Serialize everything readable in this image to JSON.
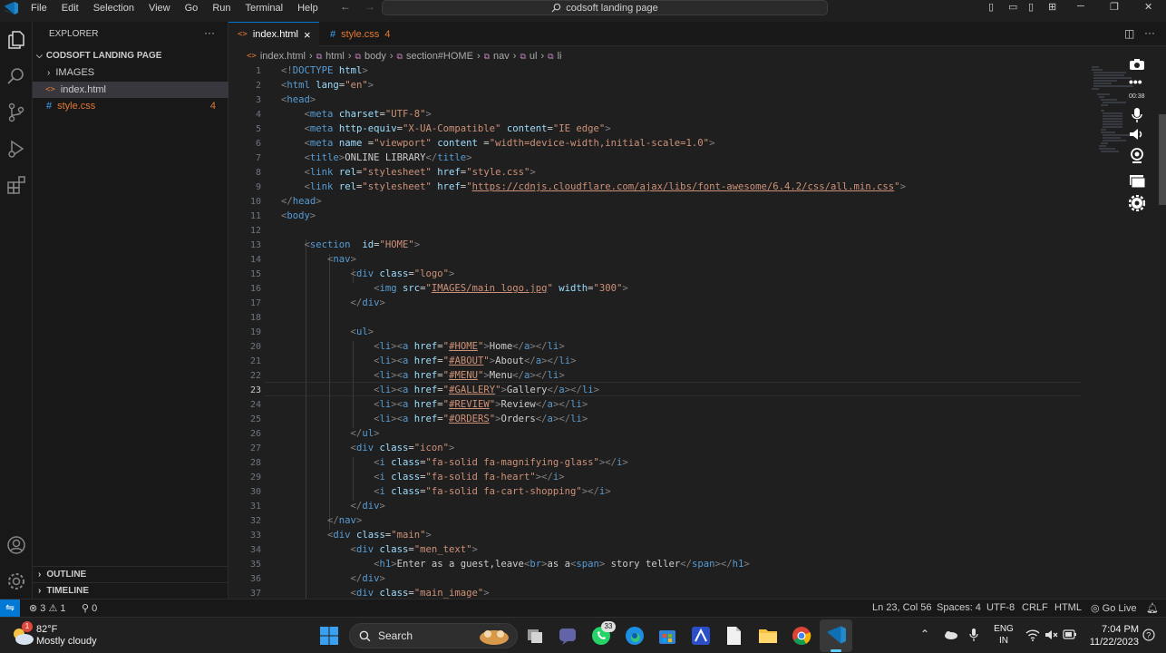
{
  "titlebar": {
    "menu": [
      "File",
      "Edit",
      "Selection",
      "View",
      "Go",
      "Run",
      "Terminal",
      "Help"
    ],
    "search": "codsoft landing page"
  },
  "explorer": {
    "header": "EXPLORER",
    "more": "···",
    "folder": "CODSOFT LANDING PAGE",
    "items": [
      {
        "name": "IMAGES",
        "type": "folder"
      },
      {
        "name": "index.html",
        "type": "html"
      },
      {
        "name": "style.css",
        "type": "css",
        "badge": "4"
      }
    ],
    "outline": "OUTLINE",
    "timeline": "TIMELINE"
  },
  "tabs": [
    {
      "label": "index.html",
      "active": true,
      "close": "×"
    },
    {
      "label": "style.css",
      "badge": "4"
    }
  ],
  "breadcrumb": [
    "index.html",
    "html",
    "body",
    "section#HOME",
    "nav",
    "ul",
    "li"
  ],
  "recorder": {
    "time": "00:38"
  },
  "editor": {
    "current_line": 23,
    "lines": [
      {
        "n": "1",
        "html": "<span class='t'>&lt;!</span><span class='n'>DOCTYPE</span> <span class='a'>html</span><span class='t'>&gt;</span>"
      },
      {
        "n": "2",
        "html": "<span class='t'>&lt;</span><span class='n'>html</span> <span class='a'>lang</span>=<span class='s'>\"en\"</span><span class='t'>&gt;</span>"
      },
      {
        "n": "3",
        "html": "<span class='t'>&lt;</span><span class='n'>head</span><span class='t'>&gt;</span>"
      },
      {
        "n": "4",
        "html": "    <span class='t'>&lt;</span><span class='n'>meta</span> <span class='a'>charset</span>=<span class='s'>\"UTF-8\"</span><span class='t'>&gt;</span>"
      },
      {
        "n": "5",
        "html": "    <span class='t'>&lt;</span><span class='n'>meta</span> <span class='a'>http-equiv</span>=<span class='s'>\"X-UA-Compatible\"</span> <span class='a'>content</span>=<span class='s'>\"IE edge\"</span><span class='t'>&gt;</span>"
      },
      {
        "n": "6",
        "html": "    <span class='t'>&lt;</span><span class='n'>meta</span> <span class='a'>name</span> =<span class='s'>\"viewport\"</span> <span class='a'>content</span> =<span class='s'>\"width=device-width,initial-scale=1.0\"</span><span class='t'>&gt;</span>"
      },
      {
        "n": "7",
        "html": "    <span class='t'>&lt;</span><span class='n'>title</span><span class='t'>&gt;</span>ONLINE LIBRARY<span class='t'>&lt;/</span><span class='n'>title</span><span class='t'>&gt;</span>"
      },
      {
        "n": "8",
        "html": "    <span class='t'>&lt;</span><span class='n'>link</span> <span class='a'>rel</span>=<span class='s'>\"stylesheet\"</span> <span class='a'>href</span>=<span class='s'>\"style.css\"</span><span class='t'>&gt;</span>"
      },
      {
        "n": "9",
        "html": "    <span class='t'>&lt;</span><span class='n'>link</span> <span class='a'>rel</span>=<span class='s'>\"stylesheet\"</span> <span class='a'>href</span>=<span class='s'>\"<span class='u'>https://cdnjs.cloudflare.com/ajax/libs/font-awesome/6.4.2/css/all.min.css</span>\"</span><span class='t'>&gt;</span>"
      },
      {
        "n": "10",
        "html": "<span class='t'>&lt;/</span><span class='n'>head</span><span class='t'>&gt;</span>"
      },
      {
        "n": "11",
        "html": "<span class='t'>&lt;</span><span class='n'>body</span><span class='t'>&gt;</span>"
      },
      {
        "n": "12",
        "html": ""
      },
      {
        "n": "13",
        "html": "    <span class='t'>&lt;</span><span class='n'>section</span>  <span class='a'>id</span>=<span class='s'>\"HOME\"</span><span class='t'>&gt;</span>"
      },
      {
        "n": "14",
        "html": "        <span class='t'>&lt;</span><span class='n'>nav</span><span class='t'>&gt;</span>"
      },
      {
        "n": "15",
        "html": "            <span class='t'>&lt;</span><span class='n'>div</span> <span class='a'>class</span>=<span class='s'>\"logo\"</span><span class='t'>&gt;</span>"
      },
      {
        "n": "16",
        "html": "                <span class='t'>&lt;</span><span class='n'>img</span> <span class='a'>src</span>=<span class='s'>\"<span class='u'>IMAGES/main logo.jpg</span>\"</span> <span class='a'>width</span>=<span class='s'>\"300\"</span><span class='t'>&gt;</span>"
      },
      {
        "n": "17",
        "html": "            <span class='t'>&lt;/</span><span class='n'>div</span><span class='t'>&gt;</span>"
      },
      {
        "n": "18",
        "html": ""
      },
      {
        "n": "19",
        "html": "            <span class='t'>&lt;</span><span class='n'>ul</span><span class='t'>&gt;</span>"
      },
      {
        "n": "20",
        "html": "                <span class='t'>&lt;</span><span class='n'>li</span><span class='t'>&gt;&lt;</span><span class='n'>a</span> <span class='a'>href</span>=<span class='s'>\"<span class='u'>#HOME</span>\"</span><span class='t'>&gt;</span>Home<span class='t'>&lt;/</span><span class='n'>a</span><span class='t'>&gt;&lt;/</span><span class='n'>li</span><span class='t'>&gt;</span>"
      },
      {
        "n": "21",
        "html": "                <span class='t'>&lt;</span><span class='n'>li</span><span class='t'>&gt;&lt;</span><span class='n'>a</span> <span class='a'>href</span>=<span class='s'>\"<span class='u'>#ABOUT</span>\"</span><span class='t'>&gt;</span>About<span class='t'>&lt;/</span><span class='n'>a</span><span class='t'>&gt;&lt;/</span><span class='n'>li</span><span class='t'>&gt;</span>"
      },
      {
        "n": "22",
        "html": "                <span class='t'>&lt;</span><span class='n'>li</span><span class='t'>&gt;&lt;</span><span class='n'>a</span> <span class='a'>href</span>=<span class='s'>\"<span class='u'>#MENU</span>\"</span><span class='t'>&gt;</span>Menu<span class='t'>&lt;/</span><span class='n'>a</span><span class='t'>&gt;&lt;/</span><span class='n'>li</span><span class='t'>&gt;</span>"
      },
      {
        "n": "23",
        "html": "                <span class='t'>&lt;</span><span class='n'>li</span><span class='t'>&gt;&lt;</span><span class='n'>a</span> <span class='a'>href</span>=<span class='s'>\"<span class='u'>#GALLERY</span>\"</span><span class='t'>&gt;</span>Gallery<span class='t'>&lt;/</span><span class='n'>a</span><span class='t'>&gt;&lt;/</span><span class='n'>li</span><span class='t'>&gt;</span>"
      },
      {
        "n": "24",
        "html": "                <span class='t'>&lt;</span><span class='n'>li</span><span class='t'>&gt;&lt;</span><span class='n'>a</span> <span class='a'>href</span>=<span class='s'>\"<span class='u'>#REVIEW</span>\"</span><span class='t'>&gt;</span>Review<span class='t'>&lt;/</span><span class='n'>a</span><span class='t'>&gt;&lt;/</span><span class='n'>li</span><span class='t'>&gt;</span>"
      },
      {
        "n": "25",
        "html": "                <span class='t'>&lt;</span><span class='n'>li</span><span class='t'>&gt;&lt;</span><span class='n'>a</span> <span class='a'>href</span>=<span class='s'>\"<span class='u'>#ORDERS</span>\"</span><span class='t'>&gt;</span>Orders<span class='t'>&lt;/</span><span class='n'>a</span><span class='t'>&gt;&lt;/</span><span class='n'>li</span><span class='t'>&gt;</span>"
      },
      {
        "n": "26",
        "html": "            <span class='t'>&lt;/</span><span class='n'>ul</span><span class='t'>&gt;</span>"
      },
      {
        "n": "27",
        "html": "            <span class='t'>&lt;</span><span class='n'>div</span> <span class='a'>class</span>=<span class='s'>\"icon\"</span><span class='t'>&gt;</span>"
      },
      {
        "n": "28",
        "html": "                <span class='t'>&lt;</span><span class='n'>i</span> <span class='a'>class</span>=<span class='s'>\"fa-solid fa-magnifying-glass\"</span><span class='t'>&gt;&lt;/</span><span class='n'>i</span><span class='t'>&gt;</span>"
      },
      {
        "n": "29",
        "html": "                <span class='t'>&lt;</span><span class='n'>i</span> <span class='a'>class</span>=<span class='s'>\"fa-solid fa-heart\"</span><span class='t'>&gt;&lt;/</span><span class='n'>i</span><span class='t'>&gt;</span>"
      },
      {
        "n": "30",
        "html": "                <span class='t'>&lt;</span><span class='n'>i</span> <span class='a'>class</span>=<span class='s'>\"fa-solid fa-cart-shopping\"</span><span class='t'>&gt;&lt;/</span><span class='n'>i</span><span class='t'>&gt;</span>"
      },
      {
        "n": "31",
        "html": "            <span class='t'>&lt;/</span><span class='n'>div</span><span class='t'>&gt;</span>"
      },
      {
        "n": "32",
        "html": "        <span class='t'>&lt;/</span><span class='n'>nav</span><span class='t'>&gt;</span>"
      },
      {
        "n": "33",
        "html": "        <span class='t'>&lt;</span><span class='n'>div</span> <span class='a'>class</span>=<span class='s'>\"main\"</span><span class='t'>&gt;</span>"
      },
      {
        "n": "34",
        "html": "            <span class='t'>&lt;</span><span class='n'>div</span> <span class='a'>class</span>=<span class='s'>\"men_text\"</span><span class='t'>&gt;</span>"
      },
      {
        "n": "35",
        "html": "                <span class='t'>&lt;</span><span class='n'>h1</span><span class='t'>&gt;</span>Enter as a guest,leave<span class='t'>&lt;</span><span class='n'>br</span><span class='t'>&gt;</span>as a<span class='t'>&lt;</span><span class='n'>span</span><span class='t'>&gt;</span> story teller<span class='t'>&lt;/</span><span class='n'>span</span><span class='t'>&gt;&lt;/</span><span class='n'>h1</span><span class='t'>&gt;</span>"
      },
      {
        "n": "36",
        "html": "            <span class='t'>&lt;/</span><span class='n'>div</span><span class='t'>&gt;</span>"
      },
      {
        "n": "37",
        "html": "            <span class='t'>&lt;</span><span class='n'>div</span> <span class='a'>class</span>=<span class='s'>\"main_image\"</span><span class='t'>&gt;</span>"
      }
    ]
  },
  "statusbar": {
    "errors": "3",
    "warnings": "1",
    "ports": "0",
    "position": "Ln 23, Col 56",
    "spaces": "Spaces: 4",
    "encoding": "UTF-8",
    "eol": "CRLF",
    "language": "HTML",
    "golive": "Go Live"
  },
  "taskbar": {
    "weather_temp": "82°F",
    "weather_desc": "Mostly cloudy",
    "weather_badge": "1",
    "search": "Search",
    "whatsapp_badge": "33",
    "lang1": "ENG",
    "lang2": "IN",
    "time": "7:04 PM",
    "date": "11/22/2023"
  },
  "colors": {
    "accent": "#0078d4",
    "tab_active_border": "#0078d4",
    "css_file": "#e37933",
    "error_badge": "#f14c4c"
  }
}
